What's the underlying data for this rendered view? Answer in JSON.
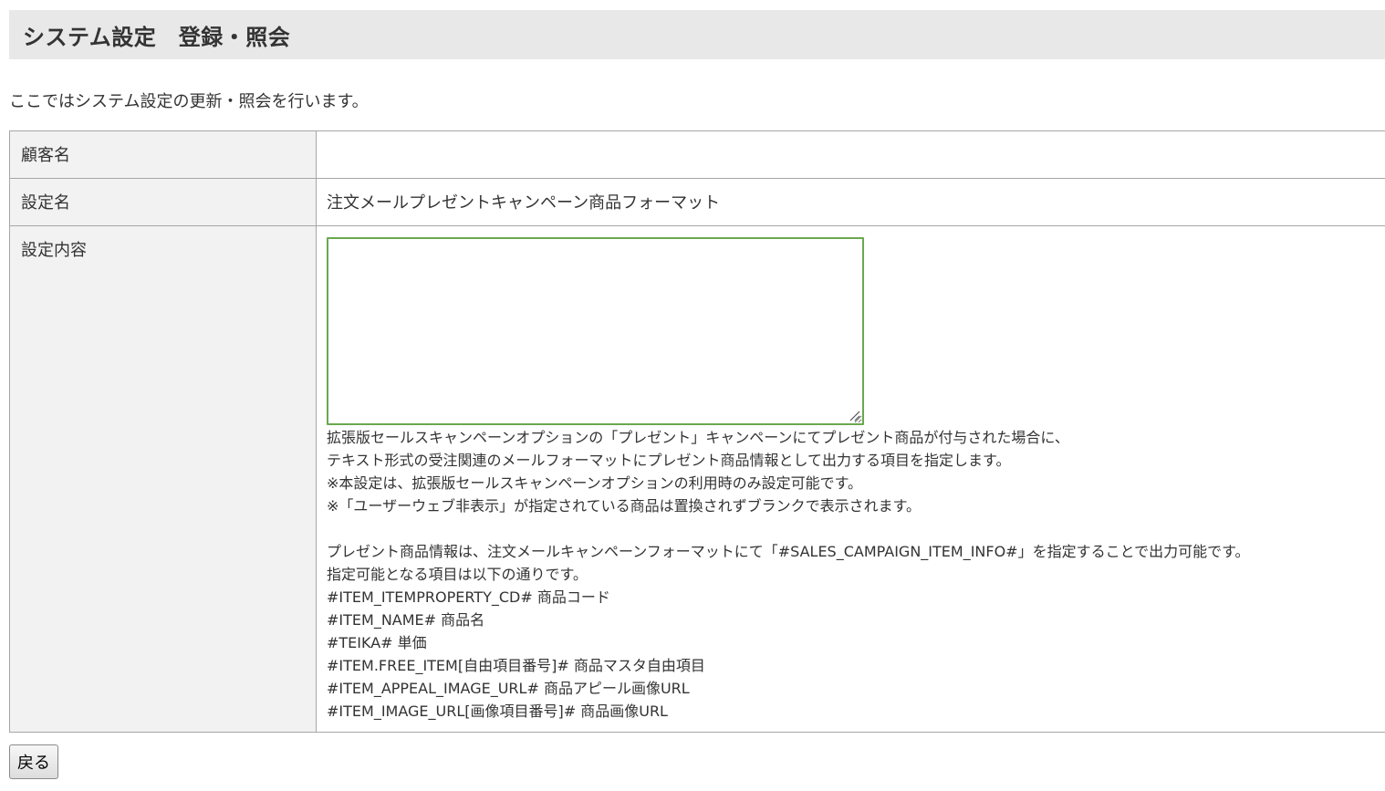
{
  "header": {
    "title": "システム設定　登録・照会"
  },
  "intro_text": "ここではシステム設定の更新・照会を行います。",
  "table": {
    "customer": {
      "label": "顧客名",
      "value": ""
    },
    "setting_name": {
      "label": "設定名",
      "value": "注文メールプレゼントキャンペーン商品フォーマット"
    },
    "setting_content": {
      "label": "設定内容",
      "textarea_value": "",
      "help_lines": [
        "拡張版セールスキャンペーンオプションの「プレゼント」キャンペーンにてプレゼント商品が付与された場合に、",
        "テキスト形式の受注関連のメールフォーマットにプレゼント商品情報として出力する項目を指定します。",
        "※本設定は、拡張版セールスキャンペーンオプションの利用時のみ設定可能です。",
        "※「ユーザーウェブ非表示」が指定されている商品は置換されずブランクで表示されます。",
        "",
        "プレゼント商品情報は、注文メールキャンペーンフォーマットにて「#SALES_CAMPAIGN_ITEM_INFO#」を指定することで出力可能です。",
        "指定可能となる項目は以下の通りです。",
        "#ITEM_ITEMPROPERTY_CD# 商品コード",
        "#ITEM_NAME# 商品名",
        "#TEIKA# 単価",
        "#ITEM.FREE_ITEM[自由項目番号]# 商品マスタ自由項目",
        "#ITEM_APPEAL_IMAGE_URL# 商品アピール画像URL",
        "#ITEM_IMAGE_URL[画像項目番号]# 商品画像URL"
      ]
    }
  },
  "back_button": {
    "label": "戻る"
  },
  "colors": {
    "title_bar_bg": "#e8e8e8",
    "label_cell_bg": "#f2f2f2",
    "border": "#a6a6a6",
    "textarea_border_focus": "#6aa84f"
  },
  "icons": {
    "textarea_resize": "resize-grip-icon"
  }
}
